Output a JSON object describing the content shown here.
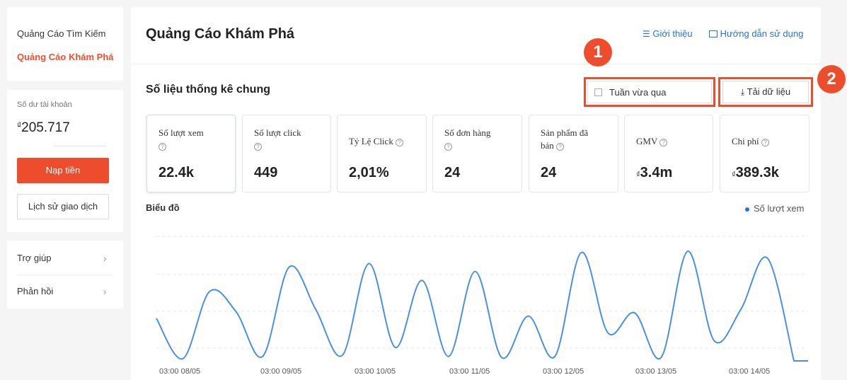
{
  "sidebar": {
    "nav": [
      {
        "label": "Quảng Cáo Tìm Kiếm",
        "active": false
      },
      {
        "label": "Quảng Cáo Khám Phá",
        "active": true
      }
    ],
    "balance_label": "Số dư tài khoản",
    "balance_value": "205.717",
    "currency": "₫",
    "topup_label": "Nạp tiền",
    "history_label": "Lịch sử giao dịch",
    "help": [
      {
        "label": "Trợ giúp"
      },
      {
        "label": "Phản hồi"
      }
    ]
  },
  "header": {
    "title": "Quảng Cáo Khám Phá",
    "intro_label": "Giới thiệu",
    "guide_label": "Hướng dẫn sử dụng"
  },
  "stats": {
    "title": "Số liệu thống kê chung",
    "date_range": "Tuần vừa qua",
    "download_label": "Tải dữ liệu",
    "kpis": [
      {
        "label_line1": "Số lượt xem",
        "label_line2": "",
        "value": "22.4k"
      },
      {
        "label_line1": "Số lượt click",
        "label_line2": "",
        "value": "449"
      },
      {
        "label_line1": "Tỷ Lệ Click",
        "label_line2": "",
        "value": "2,01%"
      },
      {
        "label_line1": "Số đơn hàng",
        "label_line2": "",
        "value": "24"
      },
      {
        "label_line1": "Sản phẩm đã",
        "label_line2": "bán",
        "value": "24"
      },
      {
        "label_line1": "GMV",
        "label_line2": "",
        "value": "3.4m"
      },
      {
        "label_line1": "Chi phí",
        "label_line2": "",
        "value": "389.3k"
      }
    ]
  },
  "chart": {
    "title": "Biểu đồ",
    "legend": "Số lượt xem",
    "color": "#4a90e2"
  },
  "annotations": {
    "badge1": "1",
    "badge2": "2",
    "color": "#ee4d2d"
  },
  "chart_data": {
    "type": "line",
    "x_ticks": [
      "03:00 08/05",
      "03:00 09/05",
      "03:00 10/05",
      "03:00 11/05",
      "03:00 12/05",
      "03:00 13/05",
      "03:00 14/05"
    ],
    "series": [
      {
        "name": "Số lượt xem",
        "values": [
          0.38,
          0.02,
          0.62,
          0.44,
          0.04,
          0.84,
          0.46,
          0.05,
          0.87,
          0.12,
          0.72,
          0.04,
          0.8,
          0.03,
          0.4,
          0.04,
          0.97,
          0.25,
          0.43,
          0.03,
          0.98,
          0.18,
          0.46,
          0.92,
          0.0
        ]
      }
    ],
    "grid": true,
    "legend_position": "top-right"
  }
}
